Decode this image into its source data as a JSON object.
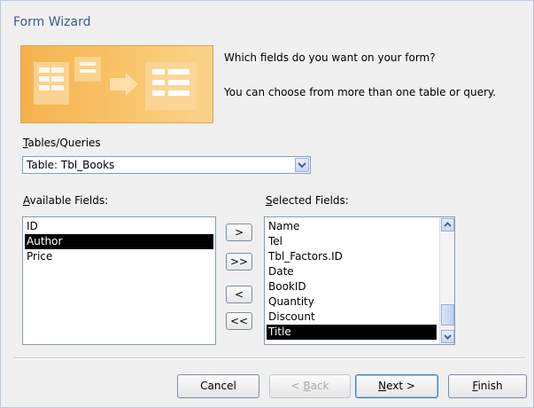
{
  "window": {
    "title": "Form Wizard"
  },
  "prompt": {
    "line1": "Which fields do you want on your form?",
    "line2": "You can choose from more than one table or query."
  },
  "tables_queries": {
    "label_u": "T",
    "label_rest": "ables/Queries",
    "selected": "Table: Tbl_Books",
    "dropdown_icon": "chevron-down-icon"
  },
  "available": {
    "label_u": "A",
    "label_rest": "vailable Fields:",
    "items": [
      "ID",
      "Author",
      "Price"
    ],
    "selected_index": 1
  },
  "selected_fields": {
    "label_u": "S",
    "label_rest": "elected Fields:",
    "items": [
      "Name",
      "Tel",
      "Tbl_Factors.ID",
      "Date",
      "BookID",
      "Quantity",
      "Discount",
      "Title"
    ],
    "selected_index": 7
  },
  "move_buttons": {
    "add_one": ">",
    "add_all": ">>",
    "remove_one": "<",
    "remove_all": "<<"
  },
  "footer": {
    "cancel": "Cancel",
    "back_pre": "< ",
    "back_u": "B",
    "back_rest": "ack",
    "next_u": "N",
    "next_rest": "ext >",
    "finish_u": "F",
    "finish_rest": "inish"
  },
  "colors": {
    "banner": "#f9c46a",
    "title_text": "#3b5a8a",
    "selection": "#000000"
  }
}
